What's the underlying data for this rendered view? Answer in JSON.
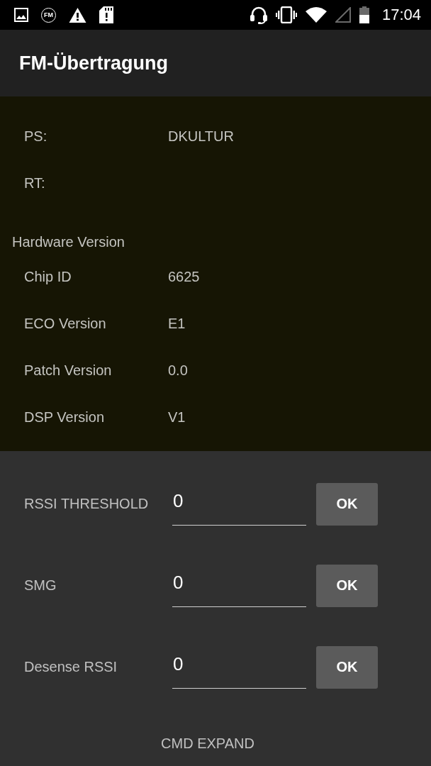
{
  "status_bar": {
    "fm_badge": "FM",
    "time": "17:04"
  },
  "app_bar": {
    "title": "FM-Übertragung"
  },
  "rds": [
    {
      "label": "PS:",
      "value": "DKULTUR"
    },
    {
      "label": "RT:"
    }
  ],
  "hardware_version": {
    "title": "Hardware Version",
    "rows": [
      {
        "label": "Chip ID",
        "value": "6625"
      },
      {
        "label": "ECO Version",
        "value": "E1"
      },
      {
        "label": "Patch Version",
        "value": "0.0"
      },
      {
        "label": "DSP Version",
        "value": "V1"
      }
    ]
  },
  "settings": [
    {
      "label": "RSSI THRESHOLD",
      "value": "0",
      "button": "OK"
    },
    {
      "label": "SMG",
      "value": "0",
      "button": "OK"
    },
    {
      "label": "Desense RSSI",
      "value": "0",
      "button": "OK"
    }
  ],
  "cmd_expand_button": "CMD EXPAND"
}
